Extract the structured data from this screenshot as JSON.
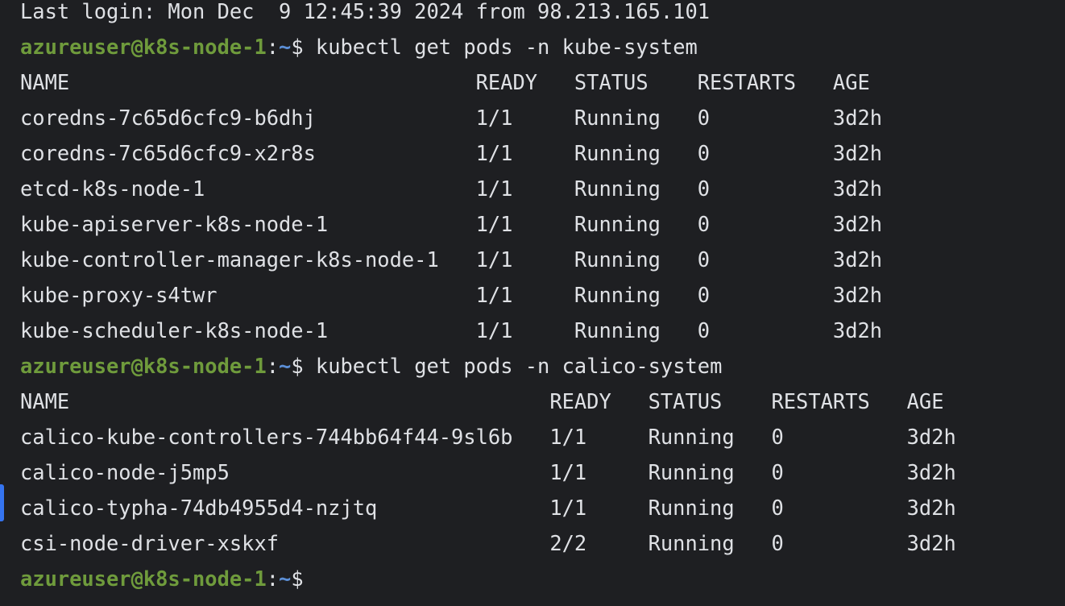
{
  "terminal": {
    "last_login": "Last login: Mon Dec  9 12:45:39 2024 from 98.213.165.101",
    "prompt": {
      "user_host": "azureuser@k8s-node-1",
      "colon": ":",
      "path": "~",
      "dollar": "$ "
    },
    "commands": [
      "kubectl get pods -n kube-system",
      "kubectl get pods -n calico-system",
      ""
    ],
    "outputs": [
      {
        "header": "NAME                                 READY   STATUS    RESTARTS   AGE",
        "rows": [
          "coredns-7c65d6cfc9-b6dhj             1/1     Running   0          3d2h",
          "coredns-7c65d6cfc9-x2r8s             1/1     Running   0          3d2h",
          "etcd-k8s-node-1                      1/1     Running   0          3d2h",
          "kube-apiserver-k8s-node-1            1/1     Running   0          3d2h",
          "kube-controller-manager-k8s-node-1   1/1     Running   0          3d2h",
          "kube-proxy-s4twr                     1/1     Running   0          3d2h",
          "kube-scheduler-k8s-node-1            1/1     Running   0          3d2h"
        ]
      },
      {
        "header": "NAME                                       READY   STATUS    RESTARTS   AGE",
        "rows": [
          "calico-kube-controllers-744bb64f44-9sl6b   1/1     Running   0          3d2h",
          "calico-node-j5mp5                          1/1     Running   0          3d2h",
          "calico-typha-74db4955d4-nzjtq              1/1     Running   0          3d2h",
          "csi-node-driver-xskxf                      2/2     Running   0          3d2h"
        ]
      }
    ]
  },
  "colors": {
    "background": "#1e1f22",
    "text": "#dfe1e5",
    "user_host": "#6f9b3c",
    "path": "#5c8fd6",
    "marker": "#3574f0"
  }
}
